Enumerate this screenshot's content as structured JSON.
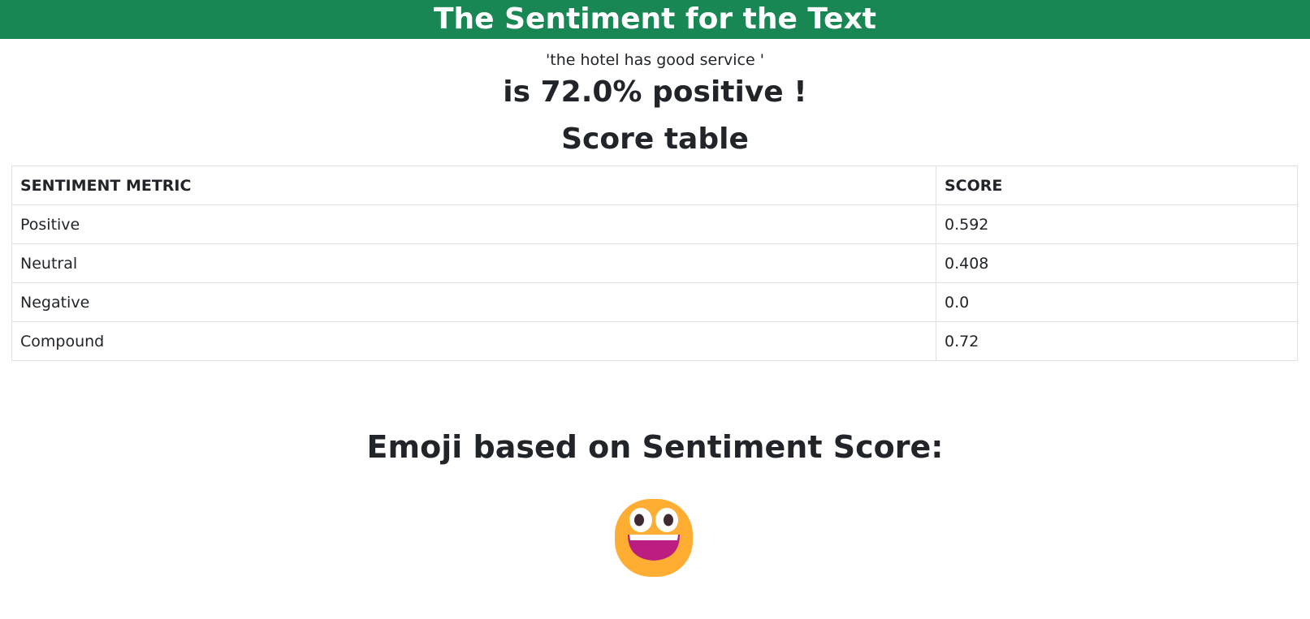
{
  "header": {
    "title": "The Sentiment for the Text"
  },
  "input_text": "'the hotel has good service '",
  "result": "is 72.0% positive !",
  "score_table": {
    "heading": "Score table",
    "columns": [
      "SENTIMENT METRIC",
      "SCORE"
    ],
    "rows": [
      {
        "metric": "Positive",
        "score": "0.592"
      },
      {
        "metric": "Neutral",
        "score": "0.408"
      },
      {
        "metric": "Negative",
        "score": "0.0"
      },
      {
        "metric": "Compound",
        "score": "0.72"
      }
    ]
  },
  "emoji_section": {
    "heading": "Emoji based on Sentiment Score:",
    "emoji": "grinning-face-icon"
  },
  "colors": {
    "header_bg": "#198754",
    "emoji_face": "#FFAE33",
    "emoji_mouth": "#BB1D80"
  }
}
